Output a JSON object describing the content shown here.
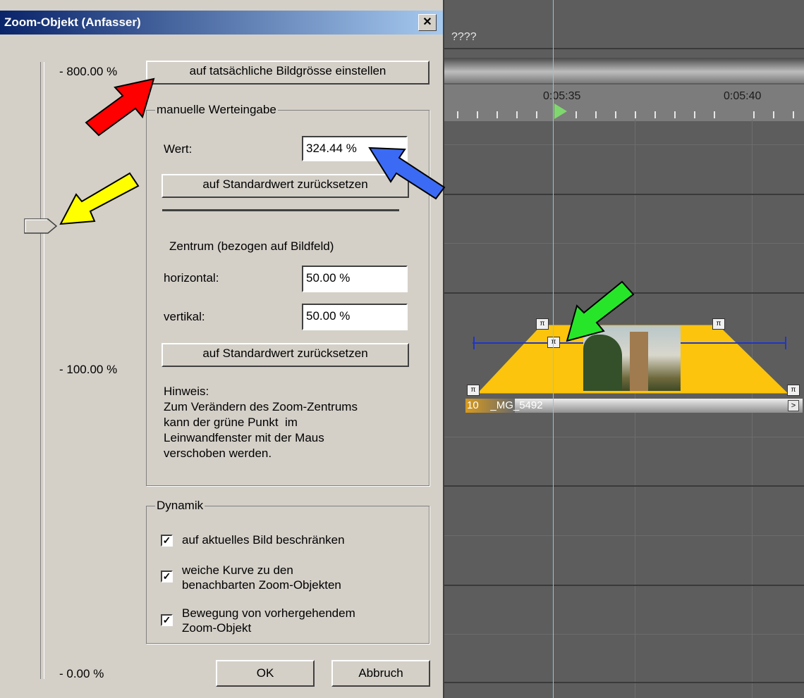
{
  "timeline": {
    "track_title": "????",
    "timecode_1": "0:05:35",
    "timecode_2": "0:05:40",
    "clip_number": "10",
    "clip_name": "_MG_5492",
    "clip_next_glyph": ">"
  },
  "dialog": {
    "title": "Zoom-Objekt (Anfasser)",
    "close_glyph": "✕",
    "scale_max": "- 800.00 %",
    "scale_mid": "- 100.00 %",
    "scale_min": "- 0.00 %",
    "actual_size_button": "auf tatsächliche Bildgrösse einstellen",
    "manual_group": {
      "legend": "manuelle Werteingabe",
      "value_label": "Wert:",
      "value": "324.44 %",
      "reset_button": "auf Standardwert zurücksetzen"
    },
    "center_group": {
      "heading": "Zentrum (bezogen auf Bildfeld)",
      "horizontal_label": "horizontal:",
      "horizontal_value": "50.00 %",
      "vertical_label": "vertikal:",
      "vertical_value": "50.00 %",
      "reset_button": "auf Standardwert zurücksetzen",
      "hint_lines": [
        "Hinweis:",
        "Zum Verändern des Zoom-Zentrums",
        "kann der grüne Punkt  im",
        "Leinwandfenster mit der Maus",
        "verschoben werden."
      ]
    },
    "dynamics_group": {
      "legend": "Dynamik",
      "option_1": "auf aktuelles Bild beschränken",
      "option_2_line1": "weiche Kurve zu den",
      "option_2_line2": "benachbarten Zoom-Objekten",
      "option_3_line1": "Bewegung von vorhergehendem",
      "option_3_line2": "Zoom-Objekt",
      "check_glyph": "✓"
    },
    "ok_button": "OK",
    "cancel_button": "Abbruch"
  },
  "colors": {
    "title_bar_start": "#0a246a",
    "title_bar_end": "#a6caf0",
    "dialog_bg": "#d4d0c8",
    "zoom_curve_fill": "#fcc40c",
    "arrow_red": "#ff0000",
    "arrow_yellow": "#ffff00",
    "arrow_blue": "#3b6bf5",
    "arrow_green": "#27e62a"
  }
}
